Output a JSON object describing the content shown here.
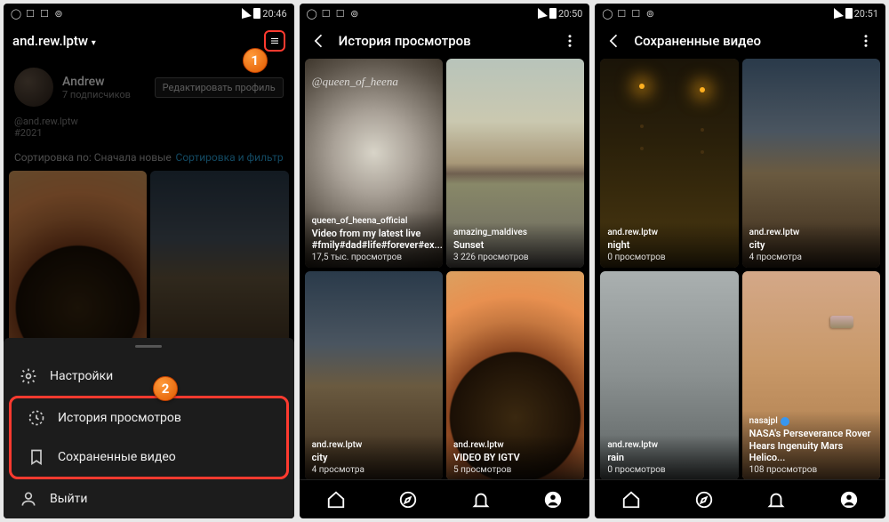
{
  "statusbar": {
    "time1": "20:46",
    "time2": "20:50",
    "time3": "20:51"
  },
  "screen1": {
    "username": "and.rew.lptw",
    "profile": {
      "name": "Andrew",
      "subscribers": "7 подписчиков",
      "handle": "@and.rew.lptw",
      "hashtag": "#2021"
    },
    "edit_button": "Редактировать профиль",
    "sort": {
      "label": "Сортировка по: Сначала новые",
      "action": "Сортировка и фильтр"
    },
    "sheet": {
      "settings": "Настройки",
      "history": "История просмотров",
      "saved": "Сохраненные видео",
      "logout": "Выйти"
    }
  },
  "screen2": {
    "title": "История просмотров",
    "watermark": "@queen_of_heena",
    "items": [
      {
        "author": "queen_of_heena_official",
        "title": "Video from my latest live #fmily#dad#life#forever#ex...",
        "views": "17,5 тыс. просмотров"
      },
      {
        "author": "amazing_maldives",
        "title": "Sunset",
        "views": "3 226 просмотров"
      },
      {
        "author": "and.rew.lptw",
        "title": "city",
        "views": "4 просмотра"
      },
      {
        "author": "and.rew.lptw",
        "title": "VIDEO BY IGTV",
        "views": "5 просмотров"
      }
    ]
  },
  "screen3": {
    "title": "Сохраненные видео",
    "items": [
      {
        "author": "and.rew.lptw",
        "title": "night",
        "views": "0 просмотров"
      },
      {
        "author": "and.rew.lptw",
        "title": "city",
        "views": "4 просмотра"
      },
      {
        "author": "and.rew.lptw",
        "title": "rain",
        "views": "0 просмотров"
      },
      {
        "author": "nasajpl",
        "verified": true,
        "title": "NASA's Perseverance Rover Hears Ingenuity Mars Helico...",
        "views": "108 просмотров"
      }
    ]
  },
  "markers": {
    "m1": "1",
    "m2": "2"
  }
}
